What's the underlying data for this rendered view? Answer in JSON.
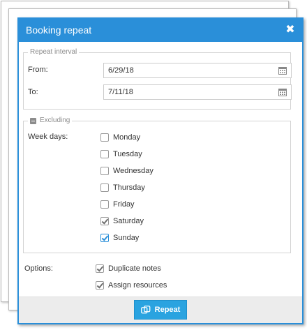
{
  "dialog": {
    "title": "Booking repeat",
    "close_icon": "close-icon"
  },
  "repeat_interval": {
    "legend": "Repeat interval",
    "from_label": "From:",
    "from_value": "6/29/18",
    "to_label": "To:",
    "to_value": "7/11/18",
    "date_picker_icon": "calendar-icon"
  },
  "excluding": {
    "legend": "Excluding",
    "legend_icon": "collapse-icon",
    "week_days_label": "Week days:",
    "days": [
      {
        "label": "Monday",
        "checked": false
      },
      {
        "label": "Tuesday",
        "checked": false
      },
      {
        "label": "Wednesday",
        "checked": false
      },
      {
        "label": "Thursday",
        "checked": false
      },
      {
        "label": "Friday",
        "checked": false
      },
      {
        "label": "Saturday",
        "checked": true
      },
      {
        "label": "Sunday",
        "checked": true
      }
    ]
  },
  "options": {
    "label": "Options:",
    "items": [
      {
        "label": "Duplicate notes",
        "checked": true
      },
      {
        "label": "Assign resources",
        "checked": true
      }
    ]
  },
  "footer": {
    "repeat_label": "Repeat",
    "repeat_icon": "repeat-icon"
  },
  "colors": {
    "accent": "#2a8fd9",
    "button": "#2aa3e0",
    "footer_bg": "#ececec"
  }
}
